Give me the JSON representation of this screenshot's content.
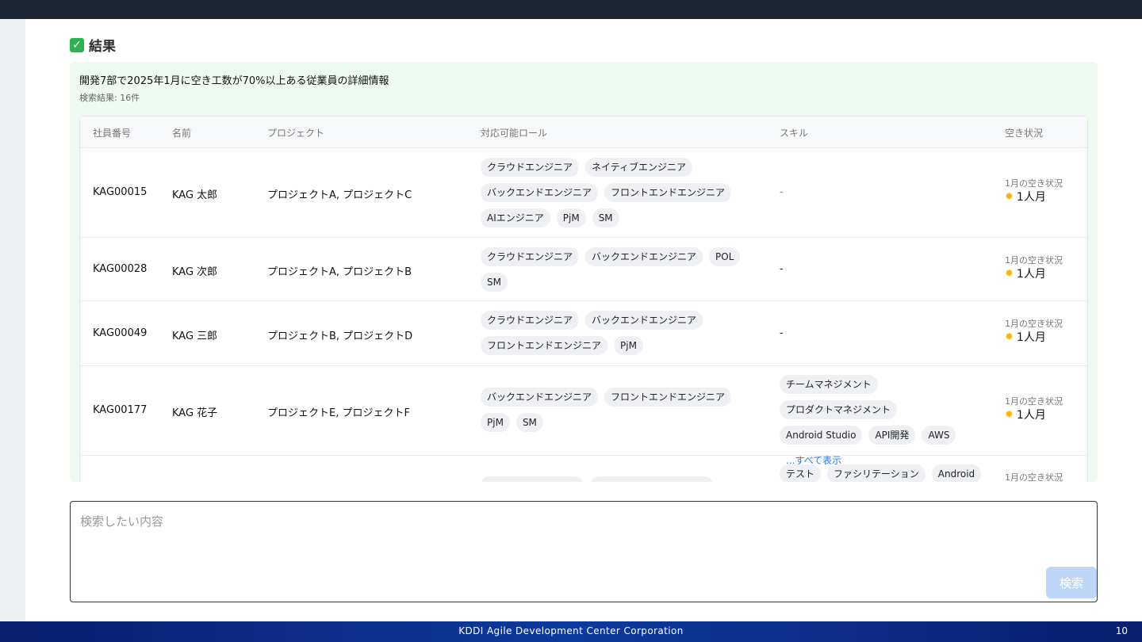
{
  "section": {
    "title": "結果"
  },
  "result": {
    "heading": "開発7部で2025年1月に空き工数が70%以上ある従業員の詳細情報",
    "count": "検索結果: 16件"
  },
  "table": {
    "headers": [
      "社員番号",
      "名前",
      "プロジェクト",
      "対応可能ロール",
      "スキル",
      "空き状況"
    ],
    "rows": [
      {
        "id": "KAG00015",
        "name": "KAG 太郎",
        "projects": "プロジェクトA, プロジェクトC",
        "roles": [
          "クラウドエンジニア",
          "ネイティブエンジニア",
          "バックエンドエンジニア",
          "フロントエンドエンジニア",
          "AIエンジニア",
          "PjM",
          "SM"
        ],
        "skills": [],
        "skills_empty": "-",
        "show_all": "",
        "avail_label": "1月の空き状況",
        "avail_value": "1人月"
      },
      {
        "id": "KAG00028",
        "name": "KAG 次郎",
        "projects": "プロジェクトA, プロジェクトB",
        "roles": [
          "クラウドエンジニア",
          "バックエンドエンジニア",
          "POL",
          "SM"
        ],
        "skills": [],
        "skills_empty": "-",
        "show_all": "",
        "avail_label": "1月の空き状況",
        "avail_value": "1人月"
      },
      {
        "id": "KAG00049",
        "name": "KAG 三郎",
        "projects": "プロジェクトB, プロジェクトD",
        "roles": [
          "クラウドエンジニア",
          "バックエンドエンジニア",
          "フロントエンドエンジニア",
          "PjM"
        ],
        "skills": [],
        "skills_empty": "-",
        "show_all": "",
        "avail_label": "1月の空き状況",
        "avail_value": "1人月"
      },
      {
        "id": "KAG00177",
        "name": "KAG 花子",
        "projects": "プロジェクトE, プロジェクトF",
        "roles": [
          "バックエンドエンジニア",
          "フロントエンドエンジニア",
          "PjM",
          "SM"
        ],
        "skills": [
          "チームマネジメント",
          "プロダクトマネジメント",
          "Android Studio",
          "API開発",
          "AWS"
        ],
        "skills_empty": "",
        "show_all": "...すべて表示",
        "avail_label": "1月の空き状況",
        "avail_value": "1人月"
      },
      {
        "id": "",
        "name": "",
        "projects": "",
        "roles": [],
        "skills": [
          "テスト",
          "ファシリテーション",
          "Android"
        ],
        "skills_empty": "",
        "show_all": "",
        "avail_label": "1月の空き状況",
        "avail_value": ""
      }
    ]
  },
  "search": {
    "placeholder": "検索したい内容",
    "button": "検索"
  },
  "footer": {
    "company": "KDDI Agile Development Center Corporation",
    "page": "10"
  },
  "icons": {
    "check": "check-icon",
    "sun": "sun-icon"
  },
  "colors": {
    "accent": "#2c7be5",
    "panel": "#eefaf1",
    "footer": "#0d2a86"
  }
}
